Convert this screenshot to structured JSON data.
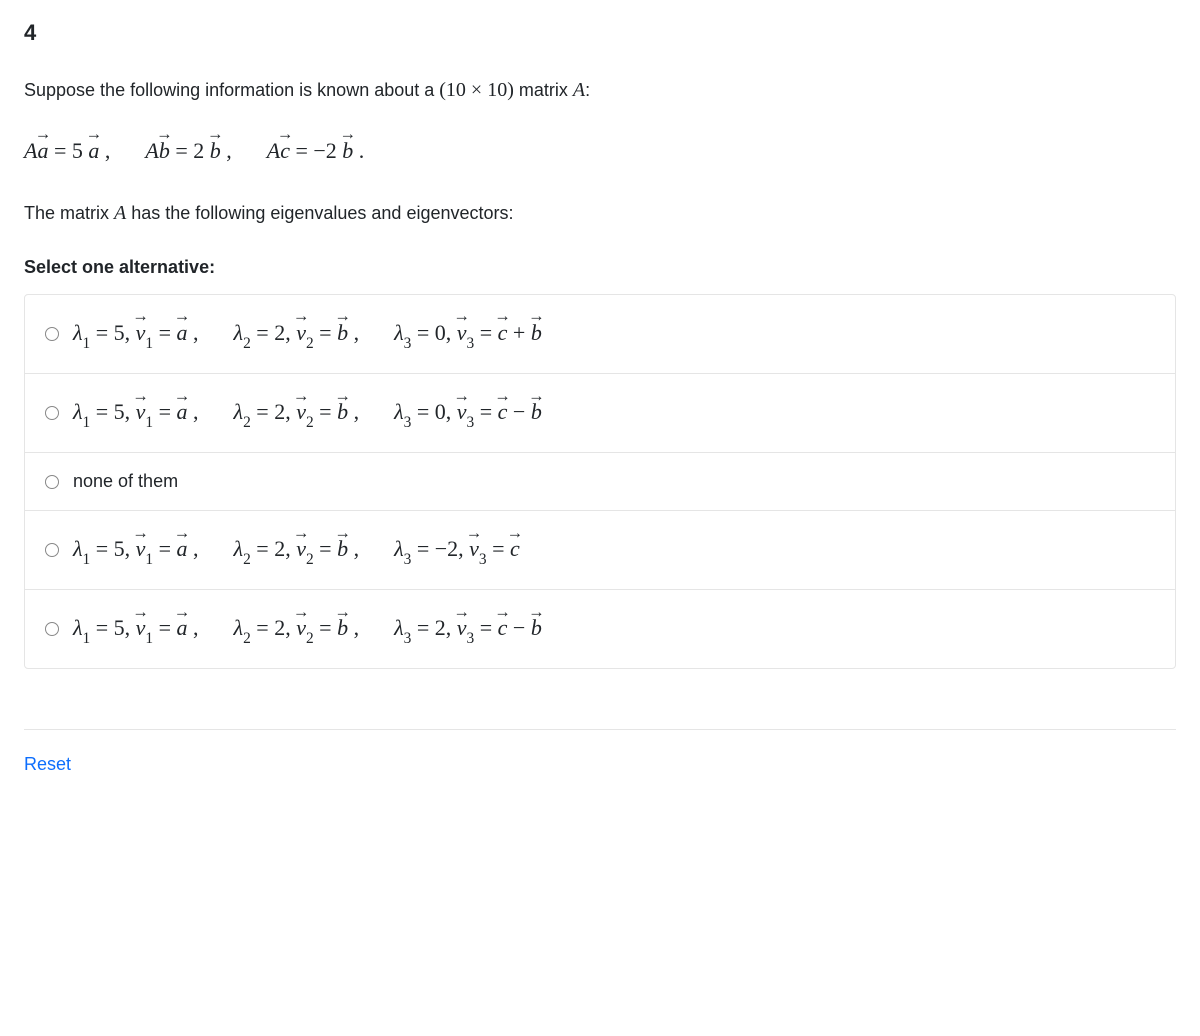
{
  "question": {
    "number": "4",
    "prompt_pre": "Suppose the following information is known about a ",
    "matrix_dim": "(10 × 10)",
    "prompt_mid": " matrix ",
    "matrix_name": "A",
    "prompt_post": ":",
    "equations": {
      "eq1_lhs_coeff": "A",
      "eq1_lhs_vec": "a",
      "eq1_eq": " = 5",
      "eq1_rhs_vec": "a",
      "sep1": " ,",
      "eq2_lhs_coeff": "A",
      "eq2_lhs_vec": "b",
      "eq2_eq": " = 2",
      "eq2_rhs_vec": "b",
      "sep2": " ,",
      "eq3_lhs_coeff": "A",
      "eq3_lhs_vec": "c",
      "eq3_eq": " = −2",
      "eq3_rhs_vec": "b",
      "sep3": " ."
    },
    "line2_pre": "The matrix ",
    "line2_matrix": "A",
    "line2_post": " has the following eigenvalues and eigenvectors:",
    "select_label": "Select one alternative:"
  },
  "options": [
    {
      "part1": "λ",
      "sub1": "1",
      "eq1": " = 5, ",
      "v1": "v",
      "vsub1": "1",
      "veq1": " = ",
      "vec1": "a",
      "c1": " ,",
      "part2": "λ",
      "sub2": "2",
      "eq2": " = 2, ",
      "v2": "v",
      "vsub2": "2",
      "veq2": " = ",
      "vec2": "b",
      "c2": " ,",
      "part3": "λ",
      "sub3": "3",
      "eq3": " = 0, ",
      "v3": "v",
      "vsub3": "3",
      "veq3": " = ",
      "vec3a": "c",
      "op3": " + ",
      "vec3b": "b"
    },
    {
      "part1": "λ",
      "sub1": "1",
      "eq1": " = 5, ",
      "v1": "v",
      "vsub1": "1",
      "veq1": " = ",
      "vec1": "a",
      "c1": " ,",
      "part2": "λ",
      "sub2": "2",
      "eq2": " = 2, ",
      "v2": "v",
      "vsub2": "2",
      "veq2": " = ",
      "vec2": "b",
      "c2": " ,",
      "part3": "λ",
      "sub3": "3",
      "eq3": " = 0, ",
      "v3": "v",
      "vsub3": "3",
      "veq3": " = ",
      "vec3a": "c",
      "op3": " − ",
      "vec3b": "b"
    },
    {
      "plain": "none of them"
    },
    {
      "part1": "λ",
      "sub1": "1",
      "eq1": " = 5, ",
      "v1": "v",
      "vsub1": "1",
      "veq1": " = ",
      "vec1": "a",
      "c1": " ,",
      "part2": "λ",
      "sub2": "2",
      "eq2": " = 2, ",
      "v2": "v",
      "vsub2": "2",
      "veq2": " = ",
      "vec2": "b",
      "c2": " ,",
      "part3": "λ",
      "sub3": "3",
      "eq3": " = −2, ",
      "v3": "v",
      "vsub3": "3",
      "veq3": " = ",
      "vec3a": "c",
      "op3": "",
      "vec3b": ""
    },
    {
      "part1": "λ",
      "sub1": "1",
      "eq1": " = 5, ",
      "v1": "v",
      "vsub1": "1",
      "veq1": " = ",
      "vec1": "a",
      "c1": " ,",
      "part2": "λ",
      "sub2": "2",
      "eq2": " = 2, ",
      "v2": "v",
      "vsub2": "2",
      "veq2": " = ",
      "vec2": "b",
      "c2": " ,",
      "part3": "λ",
      "sub3": "3",
      "eq3": " = 2, ",
      "v3": "v",
      "vsub3": "3",
      "veq3": " = ",
      "vec3a": "c",
      "op3": " − ",
      "vec3b": "b"
    }
  ],
  "reset": "Reset"
}
